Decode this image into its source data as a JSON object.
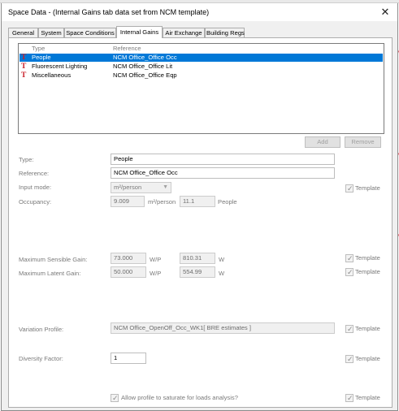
{
  "dialog": {
    "title": "Space Data - (Internal Gains tab data set from NCM template)",
    "close_glyph": "✕"
  },
  "tabs": [
    {
      "label": "General",
      "active": false
    },
    {
      "label": "System",
      "active": false
    },
    {
      "label": "Space Conditions",
      "active": false
    },
    {
      "label": "Internal Gains",
      "active": true
    },
    {
      "label": "Air Exchange",
      "active": false
    },
    {
      "label": "Building Regs",
      "active": false
    }
  ],
  "gains_list": {
    "columns": [
      "Type",
      "Reference"
    ],
    "row_icon": "T",
    "rows": [
      {
        "type": "People",
        "reference": "NCM Office_Office Occ",
        "selected": true
      },
      {
        "type": "Fluorescent Lighting",
        "reference": "NCM Office_Office Lit",
        "selected": false
      },
      {
        "type": "Miscellaneous",
        "reference": "NCM Office_Office Eqp",
        "selected": false
      }
    ]
  },
  "buttons": {
    "add": "Add",
    "remove": "Remove"
  },
  "form": {
    "type": {
      "label": "Type:",
      "value": "People"
    },
    "reference": {
      "label": "Reference:",
      "value": "NCM Office_Office Occ"
    },
    "input_mode": {
      "label": "Input mode:",
      "value": "m²/person"
    },
    "occupancy": {
      "label": "Occupancy:",
      "value": "9.009",
      "unit": "m²/person",
      "value2": "11.1",
      "unit2": "People"
    },
    "max_sensible": {
      "label": "Maximum Sensible Gain:",
      "value": "73.000",
      "unit": "W/P",
      "value2": "810.31",
      "unit2": "W"
    },
    "max_latent": {
      "label": "Maximum Latent Gain:",
      "value": "50.000",
      "unit": "W/P",
      "value2": "554.99",
      "unit2": "W"
    },
    "variation_profile": {
      "label": "Variation Profile:",
      "value": "NCM Office_OpenOff_Occ_WK1[ BRE estimates ]"
    },
    "diversity_factor": {
      "label": "Diversity Factor:",
      "value": "1"
    },
    "allow_saturate": {
      "label": "Allow profile to saturate for loads analysis?",
      "checked": true
    },
    "template_label": "Template"
  },
  "colors": {
    "selection": "#0078d7",
    "template_icon": "#c8202a"
  }
}
